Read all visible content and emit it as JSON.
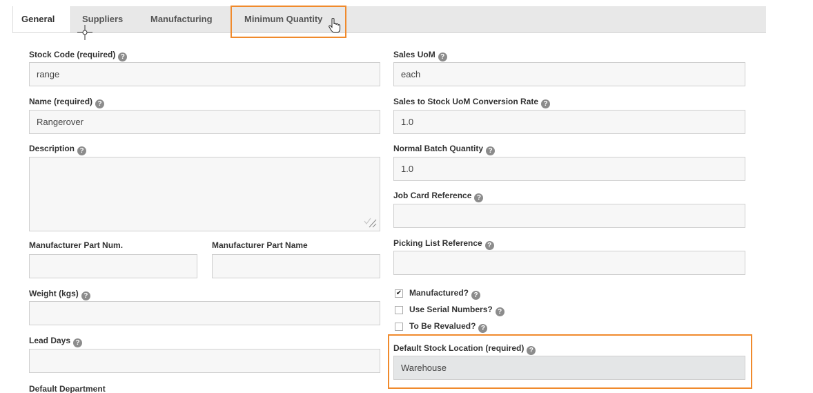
{
  "tabs": [
    {
      "label": "General",
      "active": true
    },
    {
      "label": "Suppliers",
      "active": false
    },
    {
      "label": "Manufacturing",
      "active": false
    },
    {
      "label": "Minimum Quantity",
      "active": false
    }
  ],
  "left": {
    "stock_code": {
      "label": "Stock Code (required)",
      "value": "range"
    },
    "name": {
      "label": "Name (required)",
      "value": "Rangerover"
    },
    "description": {
      "label": "Description",
      "value": ""
    },
    "mfr_part_num": {
      "label": "Manufacturer Part Num.",
      "value": ""
    },
    "mfr_part_name": {
      "label": "Manufacturer Part Name",
      "value": ""
    },
    "weight": {
      "label": "Weight (kgs)",
      "value": ""
    },
    "lead_days": {
      "label": "Lead Days",
      "value": ""
    },
    "default_department": {
      "label": "Default Department"
    }
  },
  "right": {
    "sales_uom": {
      "label": "Sales UoM",
      "value": "each"
    },
    "conversion_rate": {
      "label": "Sales to Stock UoM Conversion Rate",
      "value": "1.0"
    },
    "batch_qty": {
      "label": "Normal Batch Quantity",
      "value": "1.0"
    },
    "job_card": {
      "label": "Job Card Reference",
      "value": ""
    },
    "picking_list": {
      "label": "Picking List Reference",
      "value": ""
    },
    "checkboxes": [
      {
        "label": "Manufactured?",
        "checked": true
      },
      {
        "label": "Use Serial Numbers?",
        "checked": false
      },
      {
        "label": "To Be Revalued?",
        "checked": false
      }
    ],
    "default_location": {
      "label": "Default Stock Location (required)",
      "value": "Warehouse"
    }
  },
  "help_glyph": "?",
  "check_glyph": "✔",
  "accent_color": "#f08a2c"
}
